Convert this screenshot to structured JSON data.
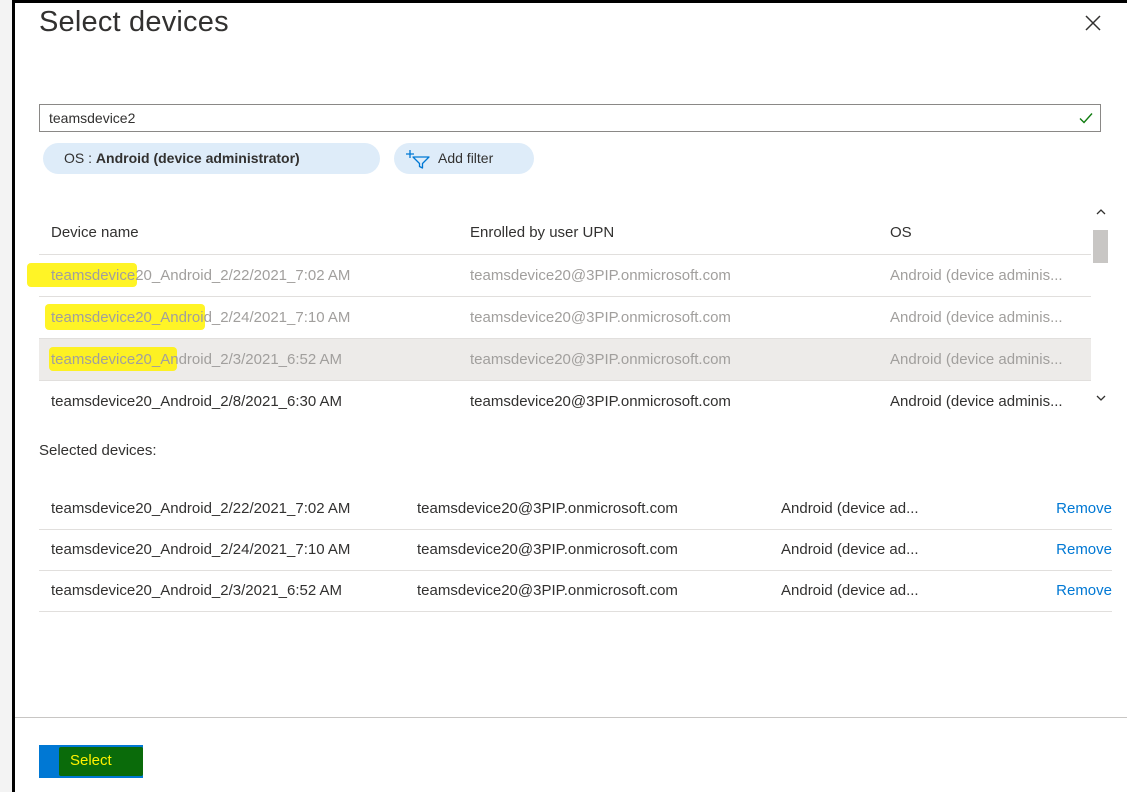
{
  "dialog": {
    "title": "Select devices"
  },
  "search": {
    "value": "teamsdevice2"
  },
  "filters": {
    "os_key": "OS : ",
    "os_value": "Android (device administrator)",
    "add_filter_label": "Add filter"
  },
  "columns": [
    "Device name",
    "Enrolled by user UPN",
    "OS"
  ],
  "devices": [
    {
      "name": "teamsdevice20_Android_2/22/2021_7:02 AM",
      "upn": "teamsdevice20@3PIP.onmicrosoft.com",
      "os": "Android (device adminis..."
    },
    {
      "name": "teamsdevice20_Android_2/24/2021_7:10 AM",
      "upn": "teamsdevice20@3PIP.onmicrosoft.com",
      "os": "Android (device adminis..."
    },
    {
      "name": "teamsdevice20_Android_2/3/2021_6:52 AM",
      "upn": "teamsdevice20@3PIP.onmicrosoft.com",
      "os": "Android (device adminis..."
    },
    {
      "name": "teamsdevice20_Android_2/8/2021_6:30 AM",
      "upn": "teamsdevice20@3PIP.onmicrosoft.com",
      "os": "Android (device adminis..."
    }
  ],
  "selected": {
    "label": "Selected devices:",
    "remove_label": "Remove",
    "items": [
      {
        "name": "teamsdevice20_Android_2/22/2021_7:02 AM",
        "upn": "teamsdevice20@3PIP.onmicrosoft.com",
        "os": "Android (device ad..."
      },
      {
        "name": "teamsdevice20_Android_2/24/2021_7:10 AM",
        "upn": "teamsdevice20@3PIP.onmicrosoft.com",
        "os": "Android (device ad..."
      },
      {
        "name": "teamsdevice20_Android_2/3/2021_6:52 AM",
        "upn": "teamsdevice20@3PIP.onmicrosoft.com",
        "os": "Android (device ad..."
      }
    ]
  },
  "footer": {
    "select_label": "Select"
  },
  "colors": {
    "accent": "#0078d4",
    "pill": "#deecf9",
    "highlight": "#fff200",
    "check": "#107c10"
  }
}
